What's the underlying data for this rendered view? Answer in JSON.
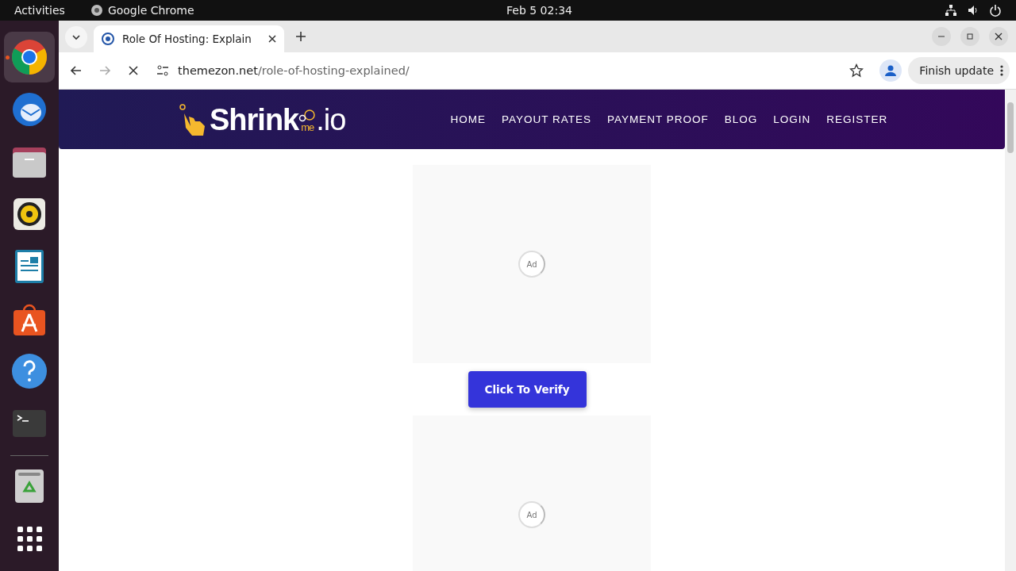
{
  "top_bar": {
    "activities": "Activities",
    "app_name": "Google Chrome",
    "clock": "Feb 5  02:34"
  },
  "dock": {
    "items": [
      {
        "kind": "chrome",
        "running": true
      },
      {
        "kind": "mail",
        "running": false
      },
      {
        "kind": "files",
        "running": false
      },
      {
        "kind": "music",
        "running": false
      },
      {
        "kind": "writer",
        "running": false
      },
      {
        "kind": "store",
        "running": false
      },
      {
        "kind": "help",
        "running": false
      },
      {
        "kind": "terminal",
        "running": false
      },
      {
        "kind": "trash",
        "running": false
      },
      {
        "kind": "apps",
        "running": false
      }
    ]
  },
  "browser": {
    "tab": {
      "title": "Role Of Hosting: Explain",
      "selected": true
    },
    "address": {
      "domain": "themezon.net",
      "path": "/role-of-hosting-explained/"
    },
    "update_button": "Finish update"
  },
  "site": {
    "logo": {
      "main": "Shrink",
      "sub": "me",
      "suffix": ".io"
    },
    "nav": [
      "HOME",
      "PAYOUT RATES",
      "PAYMENT PROOF",
      "BLOG",
      "LOGIN",
      "REGISTER"
    ],
    "ads": [
      {
        "label": "Ad"
      },
      {
        "label": "Ad"
      }
    ],
    "verify_button": "Click To Verify"
  }
}
